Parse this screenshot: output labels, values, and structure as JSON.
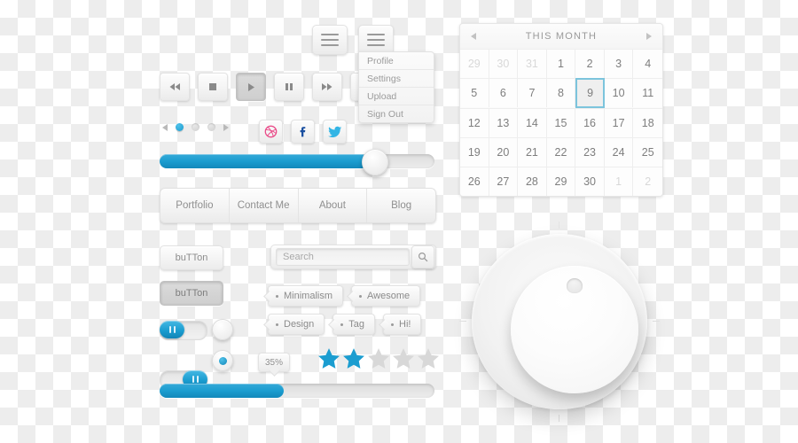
{
  "theme": {
    "accent_blue": "#1b9dd0",
    "accent_blue_light": "#4fc1e9",
    "surface": "#f4f4f4",
    "text_grey": "#8c8c8c",
    "dribbble_pink": "#ea4c89",
    "facebook_blue": "#3b5998",
    "twitter_blue": "#33b5e5",
    "selected_outline": "#7cc4dc"
  },
  "media_controls": {
    "buttons": [
      {
        "name": "rewind",
        "icon": "rewind-icon",
        "state": "normal"
      },
      {
        "name": "stop",
        "icon": "stop-icon",
        "state": "normal"
      },
      {
        "name": "play",
        "icon": "play-icon",
        "state": "pressed"
      },
      {
        "name": "pause",
        "icon": "pause-icon",
        "state": "normal"
      },
      {
        "name": "forward",
        "icon": "fast-forward-icon",
        "state": "normal"
      },
      {
        "name": "mute",
        "icon": "speaker-mute-icon",
        "state": "normal"
      }
    ]
  },
  "pagination": {
    "prev_icon": "caret-left-icon",
    "next_icon": "caret-right-icon",
    "total_dots": 3,
    "active_index": 0
  },
  "social": {
    "buttons": [
      {
        "name": "dribbble",
        "glyph": "dribbble-icon",
        "color": "#ea4c89"
      },
      {
        "name": "facebook",
        "glyph": "facebook-icon",
        "color": "#3b5998"
      },
      {
        "name": "twitter",
        "glyph": "twitter-icon",
        "color": "#33b5e5"
      }
    ]
  },
  "slider": {
    "value_percent": 76,
    "handle_icon": "slider-handle"
  },
  "progress": {
    "value_percent": 45,
    "tooltip_label": "35%"
  },
  "navbar": {
    "items": [
      {
        "label": "Portfolio"
      },
      {
        "label": "Contact Me"
      },
      {
        "label": "About"
      },
      {
        "label": "Blog"
      }
    ]
  },
  "buttons": {
    "normal_label": "buTTon",
    "pressed_label": "buTTon"
  },
  "toggles": [
    {
      "name": "toggle-off",
      "position": "left",
      "grip_icon": "pause-grip-icon"
    },
    {
      "name": "toggle-on",
      "position": "right",
      "grip_icon": "pause-grip-icon"
    }
  ],
  "radios": [
    {
      "name": "radio-unselected",
      "selected": false
    },
    {
      "name": "radio-selected",
      "selected": true
    }
  ],
  "search": {
    "placeholder": "Search",
    "value": "",
    "button_icon": "search-icon"
  },
  "tags": {
    "row1": [
      {
        "label": "Minimalism"
      },
      {
        "label": "Awesome"
      }
    ],
    "row2": [
      {
        "label": "Design"
      },
      {
        "label": "Tag"
      },
      {
        "label": "Hi!"
      }
    ]
  },
  "rating": {
    "max": 5,
    "filled": 2,
    "star_icon": "star-icon"
  },
  "menu": {
    "hamburger_icon": "hamburger-icon",
    "items": [
      {
        "label": "Profile"
      },
      {
        "label": "Settings"
      },
      {
        "label": "Upload"
      },
      {
        "label": "Sign Out"
      }
    ]
  },
  "calendar": {
    "title": "THIS MONTH",
    "prev_icon": "caret-left-icon",
    "next_icon": "caret-right-icon",
    "selected_day": "9",
    "weeks": [
      [
        {
          "d": "29",
          "muted": true
        },
        {
          "d": "30",
          "muted": true
        },
        {
          "d": "31",
          "muted": true
        },
        {
          "d": "1"
        },
        {
          "d": "2"
        },
        {
          "d": "3"
        },
        {
          "d": "4"
        }
      ],
      [
        {
          "d": "5"
        },
        {
          "d": "6"
        },
        {
          "d": "7"
        },
        {
          "d": "8"
        },
        {
          "d": "9",
          "selected": true
        },
        {
          "d": "10"
        },
        {
          "d": "11"
        }
      ],
      [
        {
          "d": "12"
        },
        {
          "d": "13"
        },
        {
          "d": "14"
        },
        {
          "d": "15"
        },
        {
          "d": "16"
        },
        {
          "d": "17"
        },
        {
          "d": "18"
        }
      ],
      [
        {
          "d": "19"
        },
        {
          "d": "20"
        },
        {
          "d": "21"
        },
        {
          "d": "22"
        },
        {
          "d": "23"
        },
        {
          "d": "24"
        },
        {
          "d": "25"
        }
      ],
      [
        {
          "d": "26"
        },
        {
          "d": "27"
        },
        {
          "d": "28"
        },
        {
          "d": "29"
        },
        {
          "d": "30"
        },
        {
          "d": "1",
          "muted": true
        },
        {
          "d": "2",
          "muted": true
        }
      ]
    ]
  },
  "knob": {
    "name": "rotary-knob",
    "indicator_icon": "knob-indicator-dot",
    "tick_count": 4
  }
}
